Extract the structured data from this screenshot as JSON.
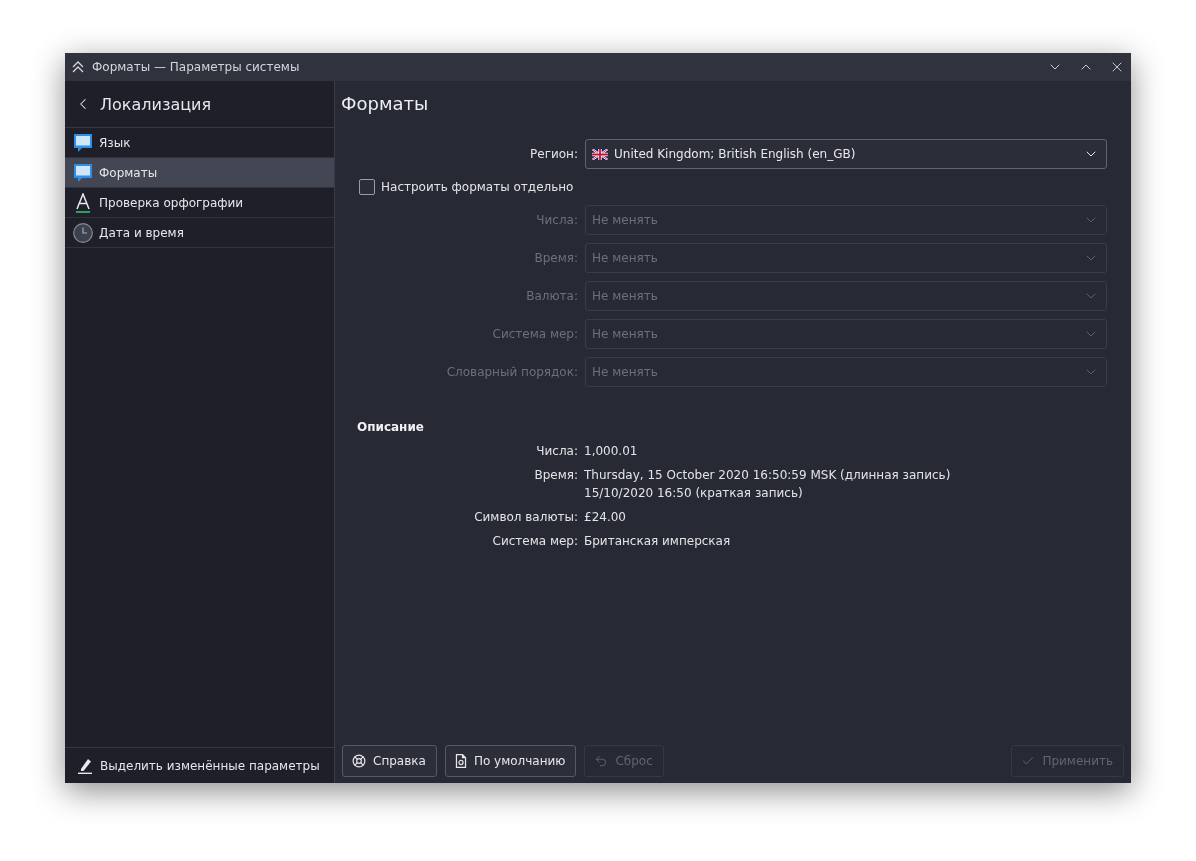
{
  "window": {
    "title": "Форматы — Параметры системы"
  },
  "sidebar": {
    "back_label": "Локализация",
    "items": [
      {
        "label": "Язык",
        "kind": "bubble",
        "selected": false
      },
      {
        "label": "Форматы",
        "kind": "bubble",
        "selected": true
      },
      {
        "label": "Проверка орфографии",
        "kind": "spelling",
        "selected": false
      },
      {
        "label": "Дата и время",
        "kind": "clock",
        "selected": false
      }
    ],
    "footer_button": "Выделить изменённые параметры"
  },
  "page": {
    "title": "Форматы",
    "region": {
      "label": "Регион:",
      "value": "United Kingdom; British English (en_GB)"
    },
    "separate_formats": {
      "label": "Настроить форматы отдельно",
      "checked": false
    },
    "format_fields": [
      {
        "label": "Числа:",
        "value": "Не менять",
        "disabled": true
      },
      {
        "label": "Время:",
        "value": "Не менять",
        "disabled": true
      },
      {
        "label": "Валюта:",
        "value": "Не менять",
        "disabled": true
      },
      {
        "label": "Система мер:",
        "value": "Не менять",
        "disabled": true
      },
      {
        "label": "Словарный порядок:",
        "value": "Не менять",
        "disabled": true
      }
    ],
    "description": {
      "heading": "Описание",
      "rows": [
        {
          "label": "Числа:",
          "lines": [
            "1,000.01"
          ]
        },
        {
          "label": "Время:",
          "lines": [
            "Thursday, 15 October 2020 16:50:59 MSK (длинная запись)",
            "15/10/2020 16:50 (краткая запись)"
          ]
        },
        {
          "label": "Символ валюты:",
          "lines": [
            "£24.00"
          ]
        },
        {
          "label": "Система мер:",
          "lines": [
            "Британская имперская"
          ]
        }
      ]
    }
  },
  "buttons": [
    {
      "label": "Справка",
      "kind": "help",
      "disabled": false
    },
    {
      "label": "По умолчанию",
      "kind": "defaults",
      "disabled": false
    },
    {
      "label": "Сброс",
      "kind": "reset",
      "disabled": true
    }
  ],
  "apply_button": {
    "label": "Применить",
    "disabled": true
  }
}
